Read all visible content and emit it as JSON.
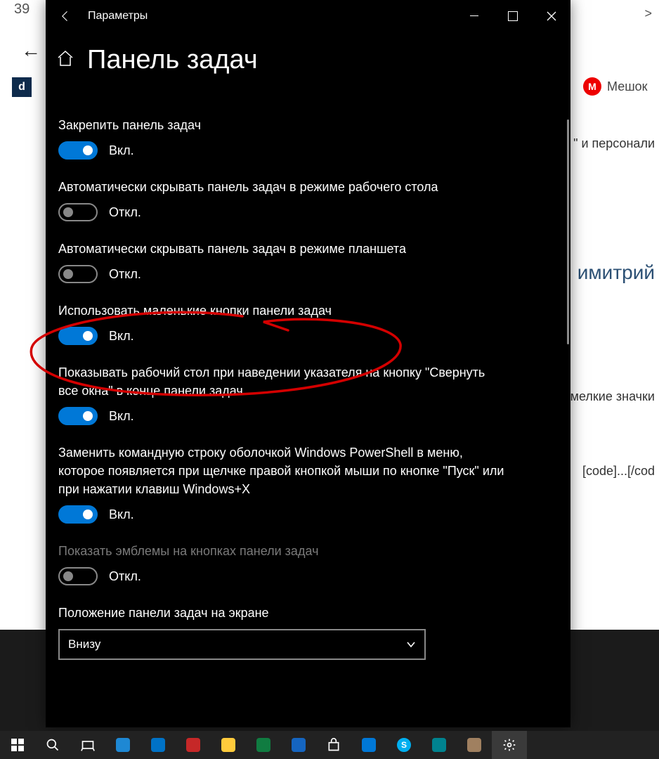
{
  "browser": {
    "badge": "39",
    "back_nav": "←",
    "scroll_right": ">",
    "d_logo": "d",
    "bookmark": {
      "letter": "M",
      "label": "Мешок"
    },
    "snippets": {
      "s1": "\" и персонали",
      "s2": "имитрий",
      "s3": "мелкие значки",
      "s4": "[code]...[/cod"
    }
  },
  "window": {
    "title": "Параметры",
    "page_title": "Панель задач",
    "state_on": "Вкл.",
    "state_off": "Откл.",
    "settings": [
      {
        "label": "Закрепить панель задач",
        "on": true
      },
      {
        "label": "Автоматически скрывать панель задач в режиме рабочего стола",
        "on": false
      },
      {
        "label": "Автоматически скрывать панель задач в режиме планшета",
        "on": false
      },
      {
        "label": "Использовать маленькие кнопки панели задач",
        "on": true
      },
      {
        "label": "Показывать рабочий стол при наведении указателя на кнопку \"Свернуть все окна\" в конце панели задач",
        "on": true
      },
      {
        "label": "Заменить командную строку оболочкой Windows PowerShell в меню, которое появляется при щелчке правой кнопкой мыши по кнопке \"Пуск\" или при нажатии клавиш Windows+X",
        "on": true
      },
      {
        "label": "Показать эмблемы на кнопках панели задач",
        "on": false,
        "disabled": true
      }
    ],
    "position": {
      "label": "Положение панели задач на экране",
      "value": "Внизу"
    }
  },
  "taskbar": {
    "items": [
      {
        "name": "start",
        "color": "#fff"
      },
      {
        "name": "search",
        "color": "#fff"
      },
      {
        "name": "task-view",
        "color": "#fff"
      },
      {
        "name": "edge",
        "color": "#1e88d4"
      },
      {
        "name": "mail",
        "color": "#0072c6"
      },
      {
        "name": "app-red",
        "color": "#c62828"
      },
      {
        "name": "explorer",
        "color": "#ffcb3c"
      },
      {
        "name": "excel",
        "color": "#107c41"
      },
      {
        "name": "app-blue",
        "color": "#1565c0"
      },
      {
        "name": "store",
        "color": "#fff"
      },
      {
        "name": "calculator",
        "color": "#0078d7"
      },
      {
        "name": "skype",
        "color": "#00aff0"
      },
      {
        "name": "app-teal",
        "color": "#00838f"
      },
      {
        "name": "app-tan",
        "color": "#a08060"
      },
      {
        "name": "settings",
        "color": "#fff"
      }
    ]
  }
}
